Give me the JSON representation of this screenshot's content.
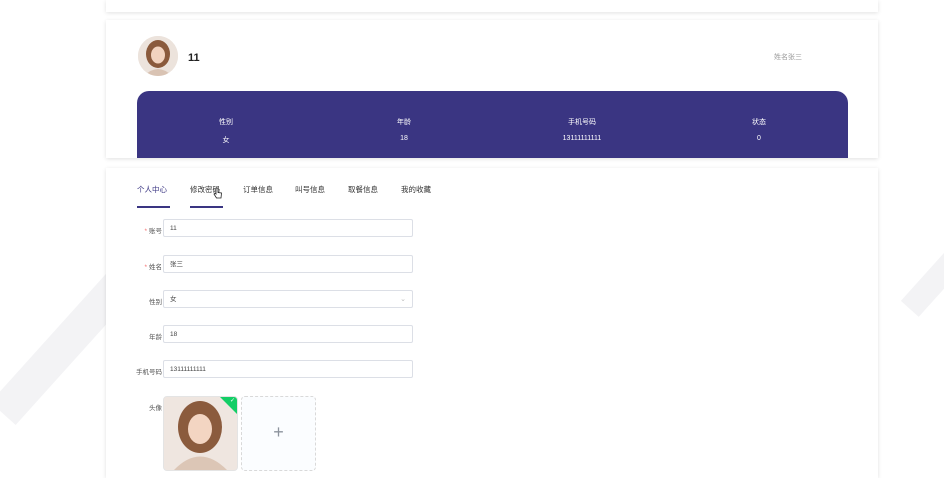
{
  "profile": {
    "username": "11",
    "name_hint": "姓名张三",
    "stats": [
      {
        "label": "性别",
        "value": "女"
      },
      {
        "label": "年龄",
        "value": "18"
      },
      {
        "label": "手机号码",
        "value": "13111111111"
      },
      {
        "label": "状态",
        "value": "0"
      }
    ]
  },
  "tabs": [
    {
      "label": "个人中心"
    },
    {
      "label": "修改密码"
    },
    {
      "label": "订单信息"
    },
    {
      "label": "叫号信息"
    },
    {
      "label": "取餐信息"
    },
    {
      "label": "我的收藏"
    }
  ],
  "form": {
    "account": {
      "label": "账号",
      "value": "11"
    },
    "name": {
      "label": "姓名",
      "value": "张三"
    },
    "gender": {
      "label": "性别",
      "value": "女"
    },
    "age": {
      "label": "年龄",
      "value": "18"
    },
    "phone": {
      "label": "手机号码",
      "value": "13111111111"
    },
    "avatar": {
      "label": "头像",
      "add_symbol": "+"
    }
  },
  "colors": {
    "accent": "#3a3582",
    "required": "#f56c6c",
    "upload_success": "#13ce66"
  }
}
